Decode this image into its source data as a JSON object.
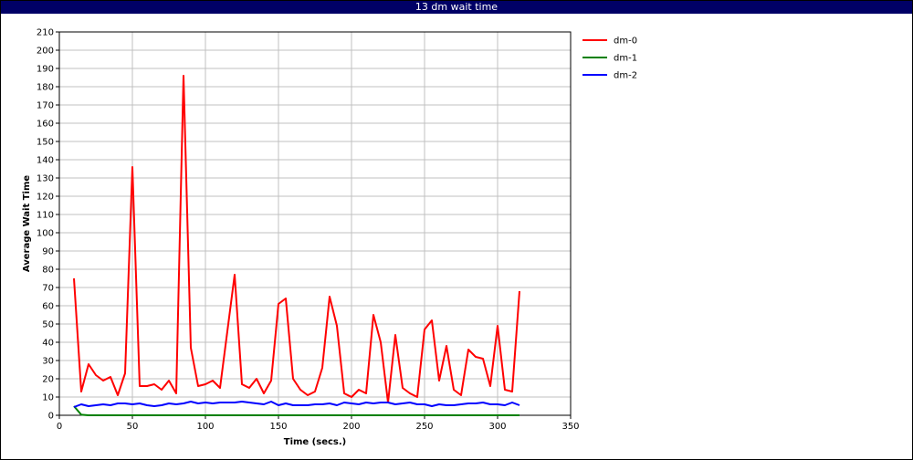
{
  "window": {
    "title": "13 dm wait time"
  },
  "chart_data": {
    "type": "line",
    "title": "13 dm wait time",
    "xlabel": "Time (secs.)",
    "ylabel": "Average Wait Time",
    "xlim": [
      0,
      350
    ],
    "ylim": [
      0,
      210
    ],
    "xticks": [
      0,
      50,
      100,
      150,
      200,
      250,
      300,
      350
    ],
    "yticks": [
      0,
      10,
      20,
      30,
      40,
      50,
      60,
      70,
      80,
      90,
      100,
      110,
      120,
      130,
      140,
      150,
      160,
      170,
      180,
      190,
      200,
      210
    ],
    "grid": true,
    "legend_position": "right",
    "series": [
      {
        "name": "dm-0",
        "color": "#ff0000",
        "x": [
          10,
          15,
          20,
          25,
          30,
          35,
          40,
          45,
          50,
          55,
          60,
          65,
          70,
          75,
          80,
          85,
          90,
          95,
          100,
          105,
          110,
          115,
          120,
          125,
          130,
          135,
          140,
          145,
          150,
          155,
          160,
          165,
          170,
          175,
          180,
          185,
          190,
          195,
          200,
          205,
          210,
          215,
          220,
          225,
          230,
          235,
          240,
          245,
          250,
          255,
          260,
          265,
          270,
          275,
          280,
          285,
          290,
          295,
          300,
          305,
          310,
          315
        ],
        "y": [
          75,
          13,
          28,
          22,
          19,
          21,
          11,
          23,
          136,
          16,
          16,
          17,
          14,
          19,
          12,
          186,
          37,
          16,
          17,
          19,
          15,
          46,
          77,
          17,
          15,
          20,
          12,
          19,
          61,
          64,
          20,
          14,
          11,
          13,
          26,
          65,
          49,
          12,
          10,
          14,
          12,
          55,
          40,
          7,
          44,
          15,
          12,
          10,
          47,
          52,
          19,
          38,
          14,
          11,
          36,
          32,
          31,
          16,
          49,
          14,
          13,
          68
        ]
      },
      {
        "name": "dm-1",
        "color": "#008000",
        "x": [
          10,
          15,
          20,
          25,
          30,
          35,
          40,
          45,
          50,
          55,
          60,
          65,
          70,
          75,
          80,
          85,
          90,
          95,
          100,
          105,
          110,
          115,
          120,
          125,
          130,
          135,
          140,
          145,
          150,
          155,
          160,
          165,
          170,
          175,
          180,
          185,
          190,
          195,
          200,
          205,
          210,
          215,
          220,
          225,
          230,
          235,
          240,
          245,
          250,
          255,
          260,
          265,
          270,
          275,
          280,
          285,
          290,
          295,
          300,
          305,
          310,
          315
        ],
        "y": [
          5,
          0.3,
          0,
          0,
          0,
          0,
          0,
          0,
          0,
          0,
          0,
          0,
          0,
          0,
          0,
          0,
          0,
          0,
          0,
          0,
          0,
          0,
          0,
          0,
          0,
          0,
          0,
          0,
          0,
          0,
          0,
          0,
          0,
          0,
          0,
          0,
          0,
          0,
          0,
          0,
          0,
          0,
          0,
          0,
          0,
          0,
          0,
          0,
          0,
          0,
          0,
          0,
          0,
          0,
          0,
          0,
          0,
          0,
          0,
          0,
          0,
          0
        ]
      },
      {
        "name": "dm-2",
        "color": "#0000ff",
        "x": [
          10,
          15,
          20,
          25,
          30,
          35,
          40,
          45,
          50,
          55,
          60,
          65,
          70,
          75,
          80,
          85,
          90,
          95,
          100,
          105,
          110,
          115,
          120,
          125,
          130,
          135,
          140,
          145,
          150,
          155,
          160,
          165,
          170,
          175,
          180,
          185,
          190,
          195,
          200,
          205,
          210,
          215,
          220,
          225,
          230,
          235,
          240,
          245,
          250,
          255,
          260,
          265,
          270,
          275,
          280,
          285,
          290,
          295,
          300,
          305,
          310,
          315
        ],
        "y": [
          4.5,
          6,
          5,
          5.5,
          6,
          5.5,
          6.5,
          6.5,
          6,
          6.5,
          5.5,
          5,
          5.5,
          6.5,
          6,
          6.5,
          7.5,
          6.5,
          7,
          6.5,
          7,
          7,
          7,
          7.5,
          7,
          6.5,
          6,
          7.5,
          5.5,
          6.5,
          5.5,
          5.5,
          5.5,
          6,
          6,
          6.5,
          5.5,
          7,
          6.5,
          6,
          7,
          6.5,
          7,
          7,
          6,
          6.5,
          7,
          6,
          6,
          5,
          6,
          5.5,
          5.5,
          6,
          6.5,
          6.5,
          7,
          6,
          6,
          5.5,
          7,
          5.5
        ]
      }
    ]
  }
}
